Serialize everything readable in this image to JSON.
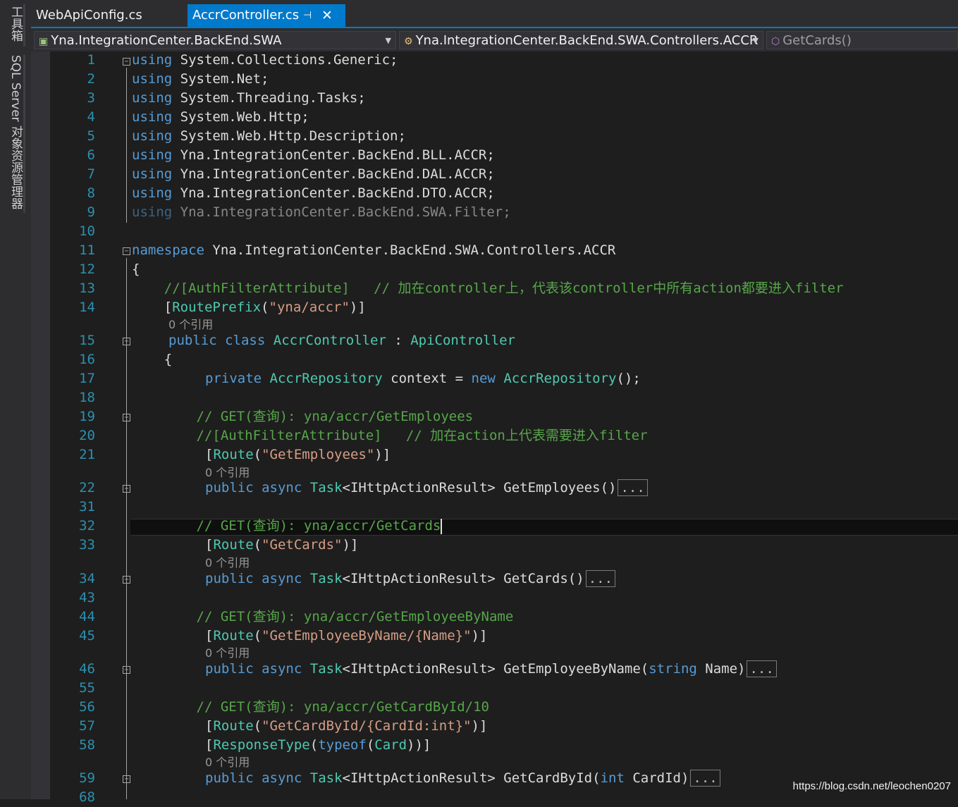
{
  "sidebar": {
    "toolbox_label": "工具箱",
    "sql_explorer_label": "SQL Server 对象资源管理器"
  },
  "tabs": [
    {
      "label": "WebApiConfig.cs",
      "active": false
    },
    {
      "label": "AccrController.cs",
      "active": true
    }
  ],
  "navbar": {
    "project": "Yna.IntegrationCenter.BackEnd.SWA",
    "class": "Yna.IntegrationCenter.BackEnd.SWA.Controllers.ACCR",
    "member": "GetCards()"
  },
  "code": {
    "ref0": "0 个引用",
    "ellipsis": "...",
    "lines": {
      "l1": {
        "n": "1",
        "a": "using",
        "b": " System.Collections.Generic;"
      },
      "l2": {
        "n": "2",
        "a": "using",
        "b": " System.Net;"
      },
      "l3": {
        "n": "3",
        "a": "using",
        "b": " System.Threading.Tasks;"
      },
      "l4": {
        "n": "4",
        "a": "using",
        "b": " System.Web.Http;"
      },
      "l5": {
        "n": "5",
        "a": "using",
        "b": " System.Web.Http.Description;"
      },
      "l6": {
        "n": "6",
        "a": "using",
        "b": " Yna.IntegrationCenter.BackEnd.BLL.ACCR;"
      },
      "l7": {
        "n": "7",
        "a": "using",
        "b": " Yna.IntegrationCenter.BackEnd.DAL.ACCR;"
      },
      "l8": {
        "n": "8",
        "a": "using",
        "b": " Yna.IntegrationCenter.BackEnd.DTO.ACCR;"
      },
      "l9": {
        "n": "9",
        "a": "using",
        "b": " Yna.IntegrationCenter.BackEnd.SWA.Filter;"
      },
      "l10": {
        "n": "10"
      },
      "l11": {
        "n": "11",
        "a": "namespace",
        "b": " Yna.IntegrationCenter.BackEnd.SWA.Controllers.ACCR"
      },
      "l12": {
        "n": "12",
        "b": "{"
      },
      "l13": {
        "n": "13",
        "c": "    //[AuthFilterAttribute]   // 加在controller上，代表该controller中所有action都要进入filter"
      },
      "l14": {
        "n": "14",
        "p1": "    [",
        "t": "RoutePrefix",
        "p2": "(",
        "s": "\"yna/accr\"",
        "p3": ")]"
      },
      "l15": {
        "n": "15",
        "a": "public",
        "b": " ",
        "a2": "class",
        "b2": " ",
        "t": "AccrController",
        "p": " : ",
        "t2": "ApiController"
      },
      "l16": {
        "n": "16",
        "b": "    {"
      },
      "l17": {
        "n": "17",
        "a": "private",
        "t": "AccrRepository",
        "p": " context = ",
        "a2": "new",
        "t2": "AccrRepository",
        "p2": "();"
      },
      "l18": {
        "n": "18"
      },
      "l19": {
        "n": "19",
        "c": "        // GET(查询): yna/accr/GetEmployees"
      },
      "l20": {
        "n": "20",
        "c": "        //[AuthFilterAttribute]   // 加在action上代表需要进入filter"
      },
      "l21": {
        "n": "21",
        "t": "Route",
        "s": "\"GetEmployees\""
      },
      "l22": {
        "n": "22",
        "a": "public",
        "a2": "async",
        "t": "Task",
        "p": "<IHttpActionResult> GetEmployees()"
      },
      "l31": {
        "n": "31"
      },
      "l32": {
        "n": "32",
        "c": "        // GET(查询): yna/accr/GetCards"
      },
      "l33": {
        "n": "33",
        "t": "Route",
        "s": "\"GetCards\""
      },
      "l34": {
        "n": "34",
        "a": "public",
        "a2": "async",
        "t": "Task",
        "p": "<IHttpActionResult> GetCards()"
      },
      "l43": {
        "n": "43"
      },
      "l44": {
        "n": "44",
        "c": "        // GET(查询): yna/accr/GetEmployeeByName"
      },
      "l45": {
        "n": "45",
        "t": "Route",
        "s": "\"GetEmployeeByName/{Name}\""
      },
      "l46": {
        "n": "46",
        "a": "public",
        "a2": "async",
        "t": "Task",
        "p": "<IHttpActionResult> GetEmployeeByName(",
        "k": "string",
        "p2": " Name)"
      },
      "l55": {
        "n": "55"
      },
      "l56": {
        "n": "56",
        "c": "        // GET(查询): yna/accr/GetCardById/10"
      },
      "l57": {
        "n": "57",
        "t": "Route",
        "s": "\"GetCardById/{CardId:int}\""
      },
      "l58": {
        "n": "58",
        "t": "ResponseType",
        "k": "typeof",
        "t2": "Card"
      },
      "l59": {
        "n": "59",
        "a": "public",
        "a2": "async",
        "t": "Task",
        "p": "<IHttpActionResult> GetCardById(",
        "k": "int",
        "p2": " CardId)"
      },
      "l68": {
        "n": "68"
      }
    }
  },
  "watermark": "https://blog.csdn.net/leochen0207",
  "colors": {
    "keyword": "#569cd6",
    "type": "#4ec9b0",
    "string": "#d69d85",
    "comment": "#57a64a",
    "line_number": "#2b91af",
    "accent": "#007acc"
  }
}
